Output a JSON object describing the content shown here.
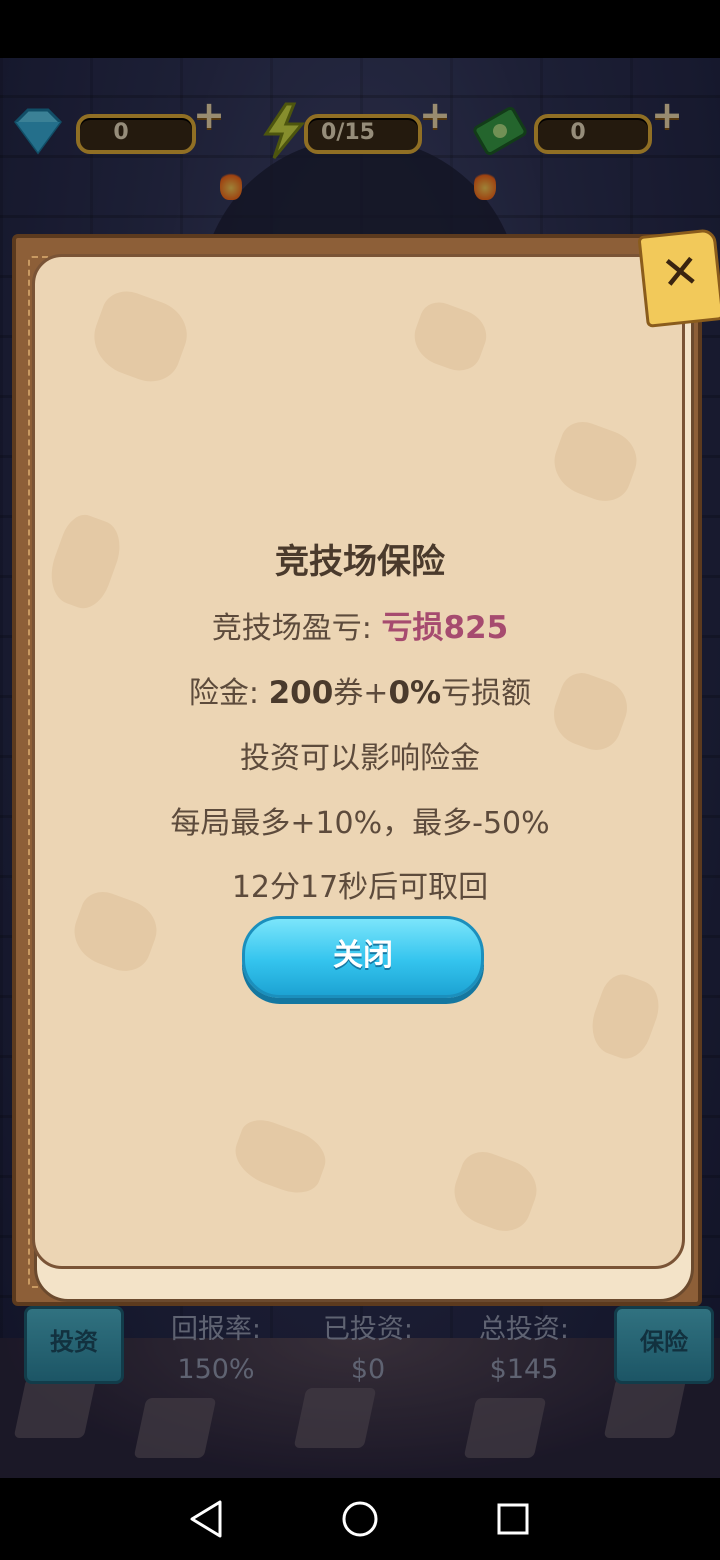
{
  "resources": {
    "gems": {
      "icon": "diamond-icon",
      "value": "0",
      "add": "+"
    },
    "energy": {
      "icon": "lightning-icon",
      "value": "0/15",
      "add": "+"
    },
    "cash": {
      "icon": "money-icon",
      "value": "0",
      "add": "+"
    }
  },
  "bottom_panel": {
    "invest_label": "投资",
    "insure_label": "保险",
    "return_rate": {
      "label": "回报率:",
      "value": "150%"
    },
    "invested": {
      "label": "已投资:",
      "value": "$0"
    },
    "total_invested": {
      "label": "总投资:",
      "value": "$145"
    }
  },
  "dialog": {
    "title": "竞技场保险",
    "pnl_label": "竞技场盈亏: ",
    "pnl_value": "亏损825",
    "premium_label": "险金: ",
    "premium_amount": "200",
    "premium_unit": "券+",
    "premium_percent": "0%",
    "premium_suffix": "亏损额",
    "note_invest": "投资可以影响险金",
    "note_limit": "每局最多+10%，最多-50%",
    "retrieve_time": "12分17秒后可取回",
    "close_button": "关闭",
    "close_icon": "close-icon"
  },
  "colors": {
    "accent_button": "#34c4ee",
    "loss_text": "#a64b6f",
    "parchment": "#ecd5b4"
  }
}
